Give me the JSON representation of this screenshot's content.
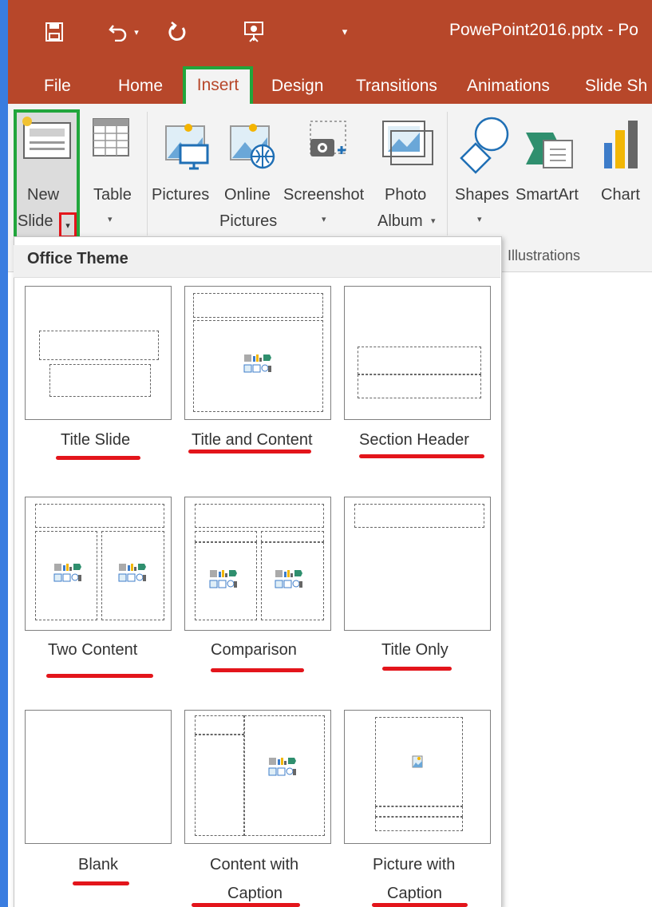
{
  "window": {
    "title": "PowePoint2016.pptx - Po"
  },
  "quick_access": {
    "icons": [
      "save-icon",
      "undo-icon",
      "redo-icon",
      "presentation-icon",
      "customize-arrow-icon"
    ]
  },
  "tabs": [
    "File",
    "Home",
    "Insert",
    "Design",
    "Transitions",
    "Animations",
    "Slide Sh"
  ],
  "active_tab": "Insert",
  "ribbon": {
    "new_slide": {
      "line1": "New",
      "line2": "Slide"
    },
    "table": {
      "label": "Table"
    },
    "pictures": {
      "label": "Pictures"
    },
    "online_pictures": {
      "line1": "Online",
      "line2": "Pictures"
    },
    "screenshot": {
      "label": "Screenshot"
    },
    "photo_album": {
      "line1": "Photo",
      "line2": "Album"
    },
    "shapes": {
      "label": "Shapes"
    },
    "smartart": {
      "label": "SmartArt"
    },
    "chart": {
      "label": "Chart"
    },
    "group_illustrations": "Illustrations"
  },
  "gallery": {
    "header": "Office Theme",
    "layouts": [
      {
        "label": "Title Slide"
      },
      {
        "label": "Title and Content"
      },
      {
        "label": "Section Header"
      },
      {
        "label": "Two Content"
      },
      {
        "label": "Comparison"
      },
      {
        "label": "Title Only"
      },
      {
        "label": "Blank"
      },
      {
        "line1": "Content with",
        "line2": "Caption"
      },
      {
        "line1": "Picture with",
        "line2": "Caption"
      }
    ]
  },
  "colors": {
    "accent": "#b7472a",
    "highlight_green": "#21a63c",
    "annotation_red": "#e3151b"
  }
}
